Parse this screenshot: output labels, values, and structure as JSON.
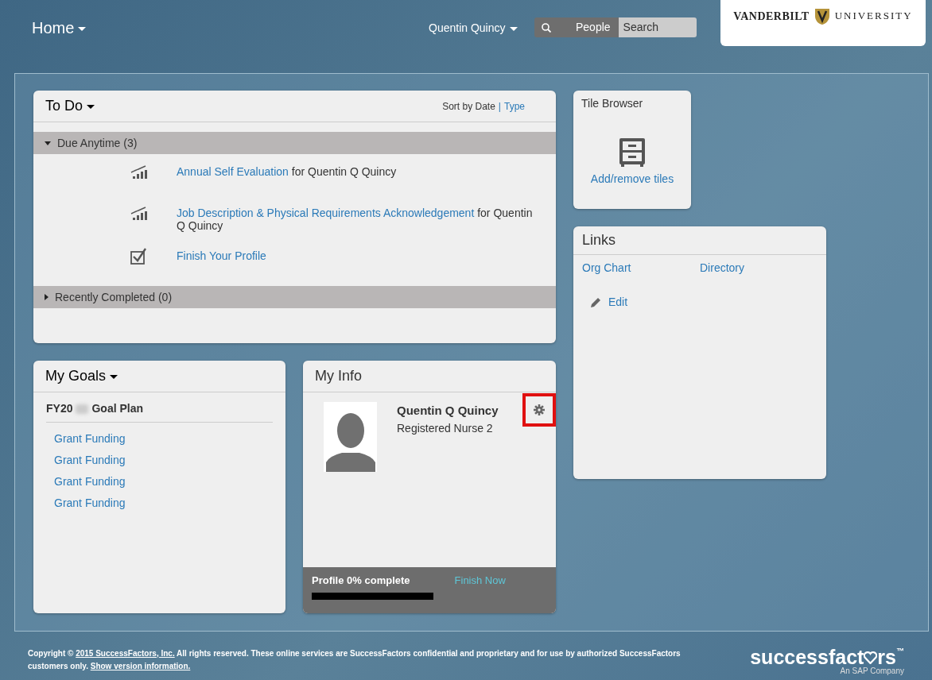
{
  "header": {
    "home_menu": "Home",
    "user_menu": "Quentin Quincy",
    "search_scope": "People",
    "search_placeholder": "Search",
    "logo_left": "VANDERBILT",
    "logo_right": "UNIVERSITY"
  },
  "todo": {
    "title": "To Do",
    "sort_label": "Sort by Date",
    "sort_separator": "|",
    "sort_link": "Type",
    "groups": [
      {
        "label": "Due Anytime (3)",
        "expanded": true,
        "items": [
          {
            "kind": "chart",
            "link": "Annual Self Evaluation",
            "suffix": " for Quentin Q Quincy"
          },
          {
            "kind": "chart",
            "link": "Job Description & Physical Requirements Acknowledgement",
            "suffix": " for Quentin Q Quincy"
          },
          {
            "kind": "check",
            "link": "Finish Your Profile"
          }
        ]
      },
      {
        "label": "Recently Completed (0)",
        "expanded": false
      }
    ]
  },
  "goals": {
    "title": "My Goals",
    "plan_prefix": "FY20",
    "plan_suffix": "Goal Plan",
    "items": [
      "Grant Funding",
      "Grant Funding",
      "Grant Funding",
      "Grant Funding"
    ]
  },
  "info": {
    "title": "My Info",
    "name": "Quentin Q Quincy",
    "job": "Registered Nurse 2",
    "settings_highlighted": true,
    "progress_label": "Profile 0% complete",
    "level": 0,
    "finish_link": "Finish Now"
  },
  "tile_browser": {
    "title": "Tile Browser",
    "link": "Add/remove tiles"
  },
  "links": {
    "title": "Links",
    "items": [
      "Org Chart",
      "Directory"
    ],
    "edit": "Edit"
  },
  "footer": {
    "copyright_prefix": "Copyright ©",
    "company_link": "2015 SuccessFactors, Inc.",
    "text": "All rights reserved. These online services are SuccessFactors confidential and proprietary and for use by authorized SuccessFactors customers only.",
    "version_link": "Show version information.",
    "brand_a": "successfact",
    "brand_b": "rs",
    "brand_tm": "™",
    "brand_sub": "An SAP Company"
  }
}
